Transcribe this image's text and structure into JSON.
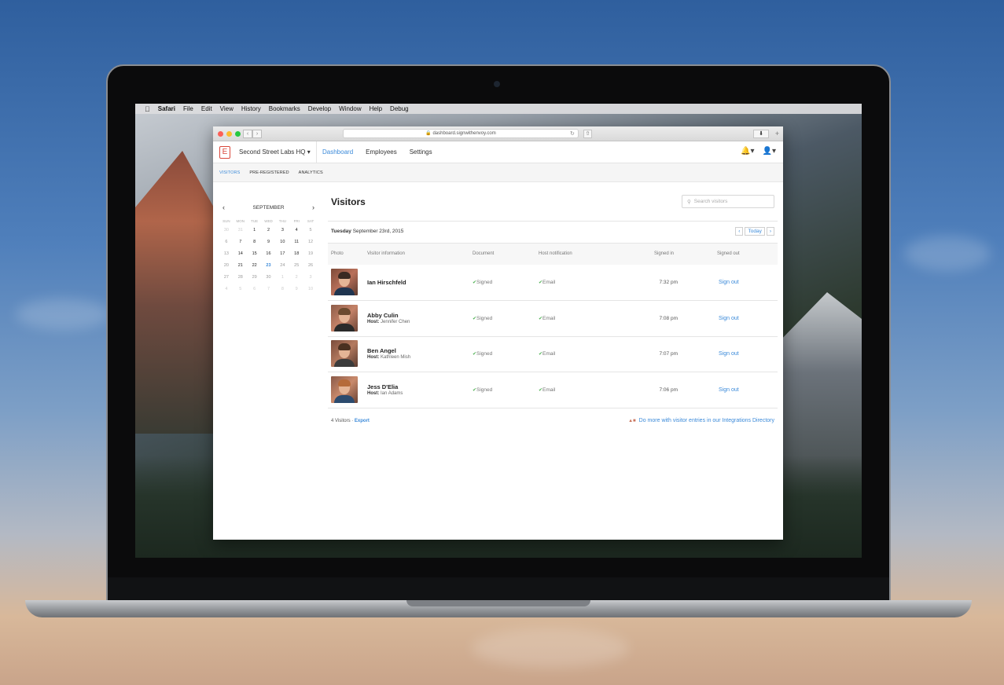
{
  "menubar": {
    "app_name": "Safari",
    "items": [
      "File",
      "Edit",
      "View",
      "History",
      "Bookmarks",
      "Develop",
      "Window",
      "Help",
      "Debug"
    ]
  },
  "browser": {
    "url": "dashboard.signwithenvoy.com"
  },
  "header": {
    "logo_letter": "E",
    "org_name": "Second Street Labs HQ",
    "nav": [
      {
        "label": "Dashboard",
        "active": true
      },
      {
        "label": "Employees",
        "active": false
      },
      {
        "label": "Settings",
        "active": false
      }
    ],
    "bell_icon": "bell-icon",
    "user_icon": "user-icon"
  },
  "subnav": {
    "tabs": [
      {
        "label": "VISITORS",
        "active": true
      },
      {
        "label": "PRE-REGISTERED",
        "active": false
      },
      {
        "label": "ANALYTICS",
        "active": false
      }
    ]
  },
  "calendar": {
    "month": "SEPTEMBER",
    "prev": "‹",
    "next": "›",
    "dow": [
      "SUN",
      "MON",
      "TUE",
      "WED",
      "THU",
      "FRI",
      "SAT"
    ],
    "weeks": [
      [
        "30",
        "31",
        "1",
        "2",
        "3",
        "4",
        "5"
      ],
      [
        "6",
        "7",
        "8",
        "9",
        "10",
        "11",
        "12"
      ],
      [
        "13",
        "14",
        "15",
        "16",
        "17",
        "18",
        "19"
      ],
      [
        "20",
        "21",
        "22",
        "23",
        "24",
        "25",
        "26"
      ],
      [
        "27",
        "28",
        "29",
        "30",
        "1",
        "2",
        "3"
      ],
      [
        "4",
        "5",
        "6",
        "7",
        "8",
        "9",
        "10"
      ]
    ]
  },
  "main": {
    "title": "Visitors",
    "search_placeholder": "Search visitors",
    "date_day": "Tuesday",
    "date_rest": "September 23rd, 2015",
    "date_prev": "‹",
    "date_today": "Today",
    "date_next": "›",
    "columns": [
      "Photo",
      "Visitor information",
      "Document",
      "Host notification",
      "Signed in",
      "Signed out"
    ],
    "visitors": [
      {
        "name": "Ian Hirschfeld",
        "host_label": "",
        "host": "",
        "document": "Signed",
        "notification": "Email",
        "signed_in": "7:32 pm",
        "signed_out": "Sign out"
      },
      {
        "name": "Abby Culin",
        "host_label": "Host:",
        "host": "Jennifer Chen",
        "document": "Signed",
        "notification": "Email",
        "signed_in": "7:08 pm",
        "signed_out": "Sign out"
      },
      {
        "name": "Ben Angel",
        "host_label": "Host:",
        "host": "Kathleen Mish",
        "document": "Signed",
        "notification": "Email",
        "signed_in": "7:07 pm",
        "signed_out": "Sign out"
      },
      {
        "name": "Jess D'Elia",
        "host_label": "Host:",
        "host": "Ian Adams",
        "document": "Signed",
        "notification": "Email",
        "signed_in": "7:06 pm",
        "signed_out": "Sign out"
      }
    ],
    "footer_count": "4 Visitors ·",
    "footer_export": "Export",
    "footer_integrations": "Do more with visitor entries in our Integrations Directory"
  },
  "colors": {
    "accent": "#3b8ad9",
    "brand": "#d9463a",
    "check": "#4caf50"
  }
}
